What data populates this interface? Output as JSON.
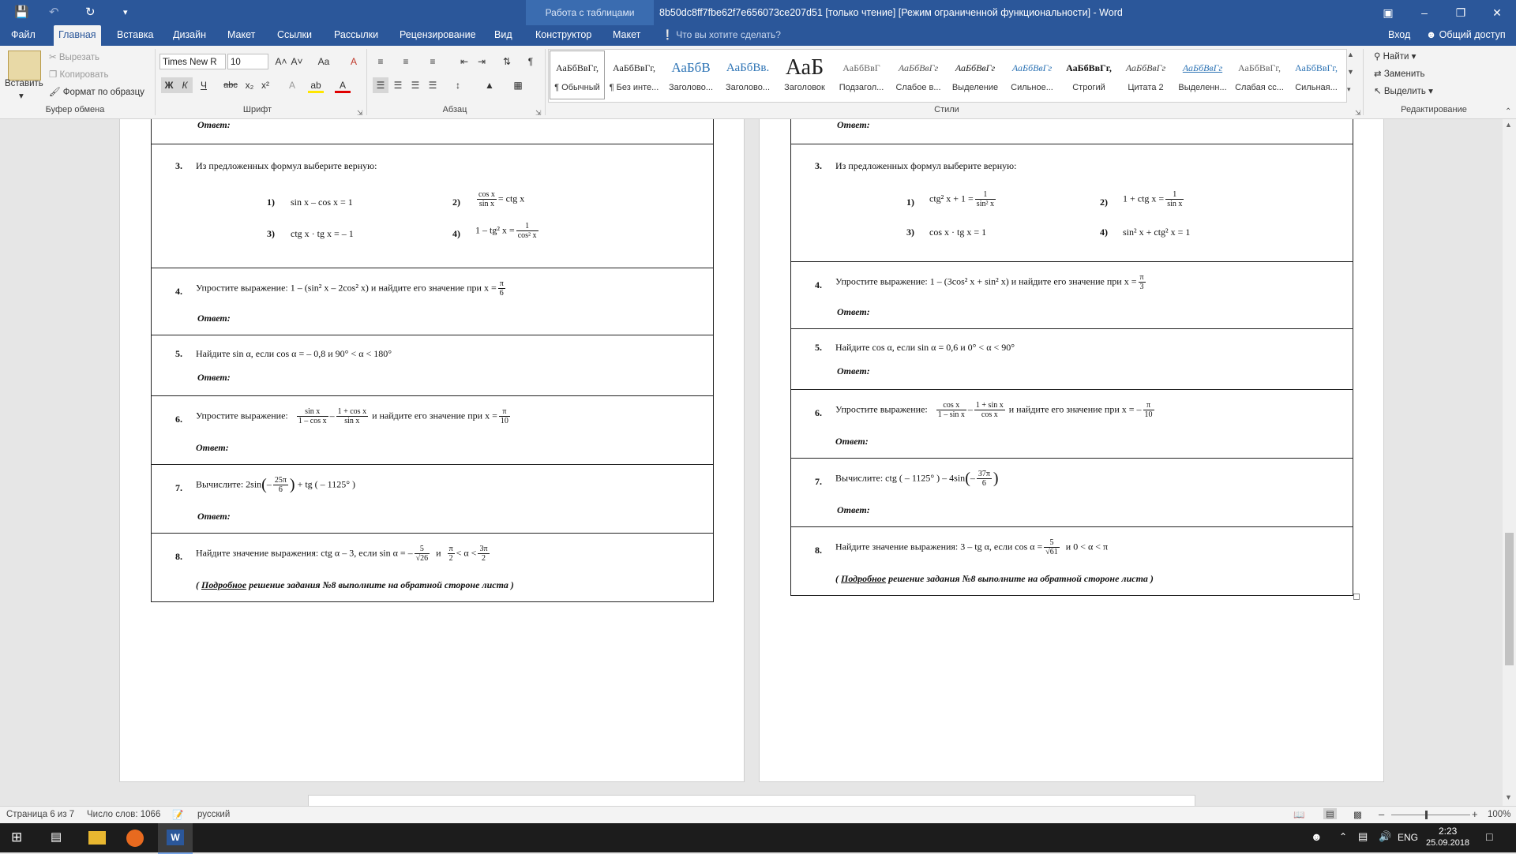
{
  "titlebar": {
    "context_tab": "Работа с таблицами",
    "doc_title": "8b50dc8ff7fbe62f7e656073ce207d51 [только чтение] [Режим ограниченной функциональности] - Word",
    "qa_save": "💾",
    "qa_undo": "↶",
    "qa_redo": "↻",
    "qa_more": "▾",
    "ribbon_opts": "▣",
    "minimize": "–",
    "maximize": "❐",
    "close": "✕"
  },
  "tabs": {
    "file": "Файл",
    "home": "Главная",
    "insert": "Вставка",
    "design": "Дизайн",
    "layout": "Макет",
    "references": "Ссылки",
    "mailings": "Рассылки",
    "review": "Рецензирование",
    "view": "Вид",
    "constructor": "Конструктор",
    "layout2": "Макет",
    "tellme": "❕ Что вы хотите сделать?",
    "signin": "Вход",
    "share": "Общий доступ"
  },
  "ribbon": {
    "clipboard": {
      "paste": "Вставить",
      "cut": "Вырезать",
      "copy": "Копировать",
      "format": "Формат по образцу",
      "label": "Буфер обмена"
    },
    "font": {
      "name": "Times New R",
      "size": "10",
      "label": "Шрифт",
      "bold": "Ж",
      "italic": "К",
      "underline": "Ч",
      "strike": "abc",
      "sub": "x₂",
      "sup": "x²",
      "grow": "A˄",
      "shrink": "A˅",
      "case": "Aa",
      "clear": "A",
      "effects": "A",
      "highlight": "ab",
      "color": "A"
    },
    "paragraph": {
      "label": "Абзац",
      "pilcrow": "¶"
    },
    "styles": {
      "label": "Стили",
      "items": [
        {
          "preview": "АаБбВвГг,",
          "name": "¶ Обычный"
        },
        {
          "preview": "АаБбВвГг,",
          "name": "¶ Без инте..."
        },
        {
          "preview": "АаБбВ",
          "name": "Заголово..."
        },
        {
          "preview": "АаБбВв.",
          "name": "Заголово..."
        },
        {
          "preview": "АаБ",
          "name": "Заголовок"
        },
        {
          "preview": "АаБбВвГ",
          "name": "Подзагол..."
        },
        {
          "preview": "АаБбВвГг",
          "name": "Слабое в..."
        },
        {
          "preview": "АаБбВвГг",
          "name": "Выделение"
        },
        {
          "preview": "АаБбВвГг",
          "name": "Сильное..."
        },
        {
          "preview": "АаБбВвГг,",
          "name": "Строгий"
        },
        {
          "preview": "АаБбВвГг",
          "name": "Цитата 2"
        },
        {
          "preview": "АаБбВвГг",
          "name": "Выделенн..."
        },
        {
          "preview": "АаБбВвГг,",
          "name": "Слабая сс..."
        },
        {
          "preview": "АаБбВвГг,",
          "name": "Сильная..."
        }
      ]
    },
    "editing": {
      "find": "Найти",
      "replace": "Заменить",
      "select": "Выделить",
      "label": "Редактирование"
    }
  },
  "left_page": {
    "answer_label": "Ответ:",
    "t3": {
      "num": "3.",
      "text": "Из предложенных формул выберите верную:",
      "o1n": "1)",
      "o1": "sin x – cos x = 1",
      "o2n": "2)",
      "o2_num": "cos x",
      "o2_den": "sin x",
      "o2_rest": "= ctg x",
      "o3n": "3)",
      "o3": "ctg x · tg x = – 1",
      "o4n": "4)",
      "o4_left": "1 – tg² x =",
      "o4_num": "1",
      "o4_den": "cos² x"
    },
    "t4": {
      "num": "4.",
      "text": "Упростите выражение:   1 – (sin² x – 2cos² x)   и найдите его значение при  x =",
      "fn": "π",
      "fd": "6"
    },
    "t5": {
      "num": "5.",
      "text": "Найдите sin α, если  cos α = – 0,8  и  90° < α < 180°"
    },
    "t6": {
      "num": "6.",
      "lead": "Упростите выражение:",
      "a_n": "sin x",
      "a_d": "1 – cos x",
      "op": "–",
      "b_n": "1 + cos x",
      "b_d": "sin x",
      "tail": "и найдите его значение при  x =",
      "fn": "π",
      "fd": "10"
    },
    "t7": {
      "num": "7.",
      "lead": "Вычислите:   2sin",
      "lp": "(",
      "minus": "–",
      "fn": "25π",
      "fd": "6",
      "rp": ")",
      "tail": "+ tg ( – 1125° )"
    },
    "t8": {
      "num": "8.",
      "text": "Найдите значение выражения:   ctg α – 3,  если  sin α = –",
      "fn": "5",
      "fd": "√26",
      "mid": "и",
      "gn": "π",
      "gd": "2",
      "lt": "< α <",
      "hn": "3π",
      "hd": "2",
      "note_open": "( ",
      "note_u": "Подробное",
      "note_rest": "  решение задания №8 выполните на обратной стороне листа )"
    }
  },
  "right_page": {
    "answer_label": "Ответ:",
    "t3": {
      "num": "3.",
      "text": "Из предложенных формул выберите верную:",
      "o1n": "1)",
      "o1_left": "ctg² x + 1 =",
      "o1_num": "1",
      "o1_den": "sin² x",
      "o2n": "2)",
      "o2_left": "1 + ctg x =",
      "o2_num": "1",
      "o2_den": "sin x",
      "o3n": "3)",
      "o3": "cos x · tg x = 1",
      "o4n": "4)",
      "o4": "sin² x + ctg² x = 1"
    },
    "t4": {
      "num": "4.",
      "text": "Упростите выражение:   1 – (3cos² x + sin² x)   и найдите его значение при  x =",
      "fn": "π",
      "fd": "3"
    },
    "t5": {
      "num": "5.",
      "text": "Найдите cos α, если  sin α = 0,6  и  0° < α < 90°"
    },
    "t6": {
      "num": "6.",
      "lead": "Упростите выражение:",
      "a_n": "cos x",
      "a_d": "1 – sin x",
      "op": "–",
      "b_n": "1 + sin x",
      "b_d": "cos x",
      "tail": "и найдите его значение при  x = –",
      "fn": "π",
      "fd": "10"
    },
    "t7": {
      "num": "7.",
      "lead": "Вычислите:   ctg ( – 1125° ) – 4sin",
      "lp": "(",
      "minus": "–",
      "fn": "37π",
      "fd": "6",
      "rp": ")"
    },
    "t8": {
      "num": "8.",
      "text": "Найдите значение выражения:   3 – tg α, если  cos α =",
      "fn": "5",
      "fd": "√61",
      "tail": "и   0 < α < π",
      "note_open": "( ",
      "note_u": "Подробное",
      "note_rest": "  решение задания №8 выполните на обратной стороне листа )"
    }
  },
  "status": {
    "page": "Страница 6 из 7",
    "words": "Число слов: 1066",
    "lang": "русский",
    "zoom": "100%"
  },
  "taskbar": {
    "lang": "ENG",
    "time": "2:23",
    "date": "25.09.2018"
  }
}
